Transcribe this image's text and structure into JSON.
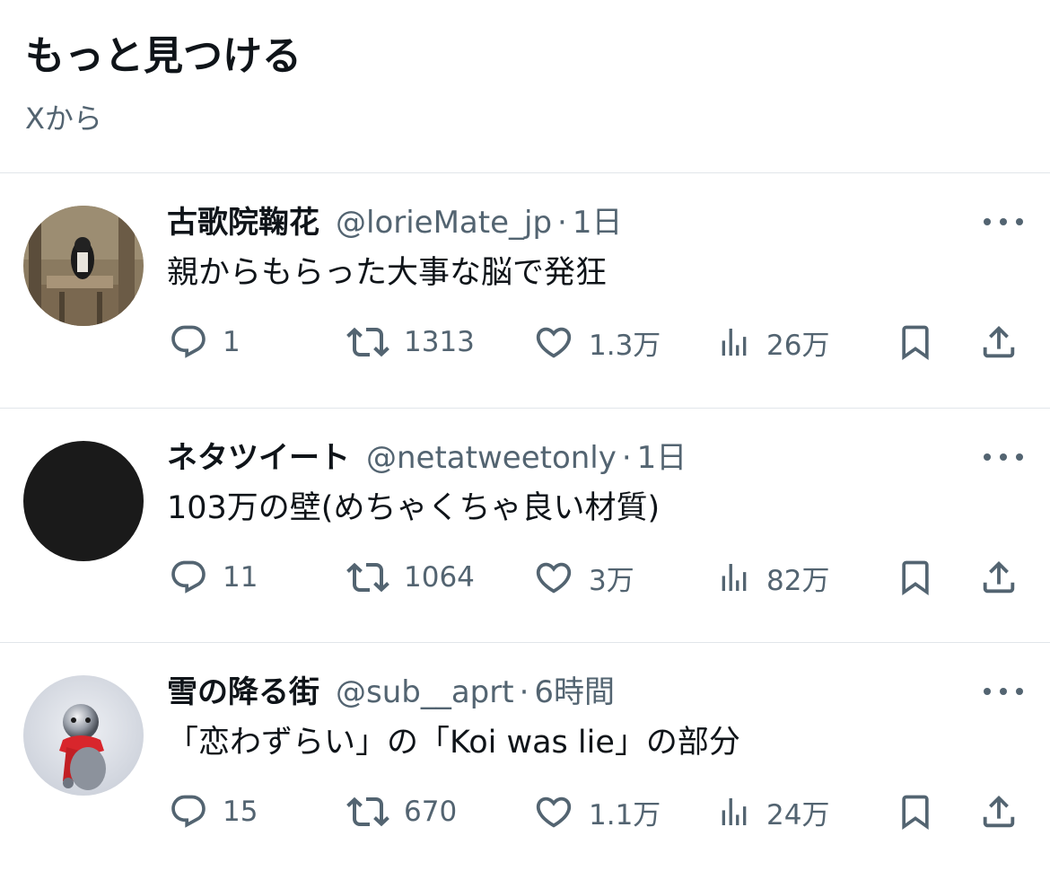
{
  "header": {
    "title": "もっと見つける",
    "subtitle": "Xから"
  },
  "tweets": [
    {
      "display_name": "古歌院鞠花",
      "handle": "@lorieMate_jp",
      "separator": "·",
      "time": "1日",
      "text": "親からもらった大事な脳で発狂",
      "replies": "1",
      "retweets": "1313",
      "likes": "1.3万",
      "views": "26万"
    },
    {
      "display_name": "ネタツイート",
      "handle": "@netatweetonly",
      "separator": "·",
      "time": "1日",
      "text": "103万の壁(めちゃくちゃ良い材質)",
      "replies": "11",
      "retweets": "1064",
      "likes": "3万",
      "views": "82万"
    },
    {
      "display_name": "雪の降る街",
      "handle": "@sub__aprt",
      "separator": "·",
      "time": "6時間",
      "text": "「恋わずらい」の「Koi was lie」の部分",
      "replies": "15",
      "retweets": "670",
      "likes": "1.1万",
      "views": "24万"
    }
  ],
  "icons": {
    "reply": "reply-icon",
    "retweet": "retweet-icon",
    "like": "heart-icon",
    "views": "views-icon",
    "bookmark": "bookmark-icon",
    "share": "share-icon",
    "more": "more-icon"
  },
  "colors": {
    "text_primary": "#0f1419",
    "text_secondary": "#536471",
    "divider": "#e1e6ea",
    "avatar_dark": "#1a1a1a",
    "scarf_red": "#d8262c"
  }
}
